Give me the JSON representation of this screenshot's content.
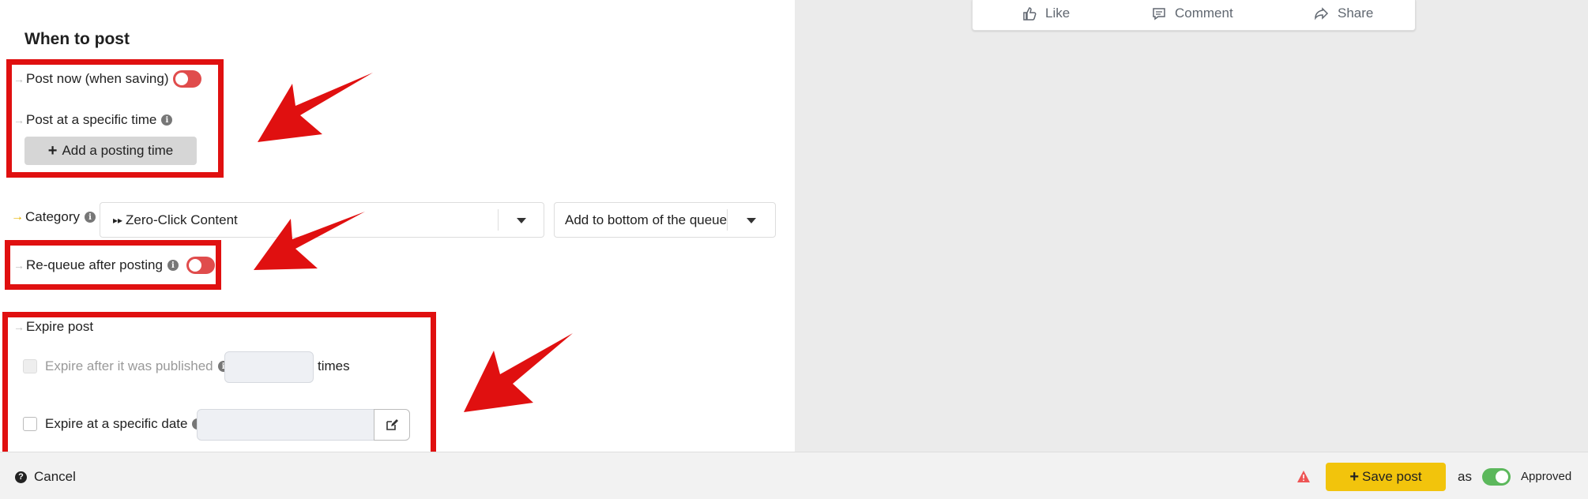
{
  "preview": {
    "like_label": "Like",
    "comment_label": "Comment",
    "share_label": "Share"
  },
  "when": {
    "title": "When to post",
    "post_now_label": "Post now (when saving)",
    "post_now_on": false,
    "specific_time_label": "Post at a specific time",
    "add_time_label": "Add a posting time"
  },
  "category": {
    "label": "Category",
    "value": "Zero-Click Content",
    "queue_value": "Add to bottom of the queue"
  },
  "requeue": {
    "label": "Re-queue after posting",
    "on": false
  },
  "expire": {
    "title": "Expire post",
    "after_published_label": "Expire after it was published",
    "times_label": "times",
    "times_value": "",
    "specific_date_label": "Expire at a specific date",
    "date_value": ""
  },
  "footer": {
    "cancel_label": "Cancel",
    "save_label": "Save post",
    "as_label": "as",
    "status_label": "Approved",
    "status_on": true
  },
  "colors": {
    "annotation_red": "#e01010",
    "save_yellow": "#f2c40c",
    "toggle_off": "#e04c4c",
    "toggle_on": "#5cb85c"
  }
}
